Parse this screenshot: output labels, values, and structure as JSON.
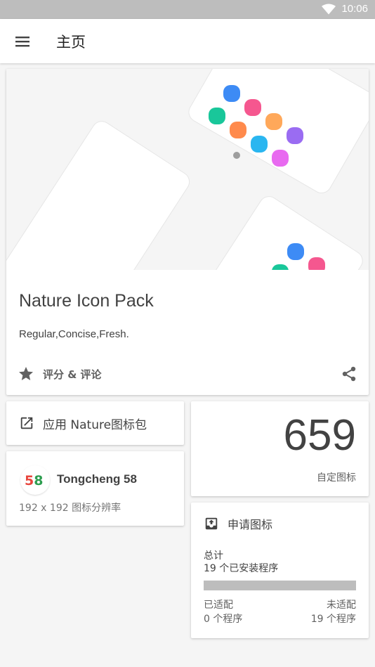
{
  "status_bar": {
    "time": "10:06",
    "wifi_icon": "wifi-icon"
  },
  "app_bar": {
    "title": "主页",
    "menu_icon": "menu-icon"
  },
  "hero": {
    "title": "Nature Icon Pack",
    "subtitle": "Regular,Concise,Fresh.",
    "rate_label": "评分 & 评论",
    "rate_icon": "star-icon",
    "share_icon": "share-icon",
    "dot_colors": [
      "#3d8bf5",
      "#f5578f",
      "#19c79a",
      "#ff8a4c",
      "#ffa85a",
      "#9a6cf2",
      "#2ab6f0",
      "#e86af0"
    ]
  },
  "apply": {
    "label": "应用 Nature图标包",
    "icon": "open-in-new-icon"
  },
  "launcher": {
    "name": "Tongcheng 58",
    "resolution": "192 x 192 图标分辨率",
    "logo_text": "58"
  },
  "icon_count": {
    "value": "659",
    "label": "自定图标"
  },
  "request": {
    "title": "申请图标",
    "icon": "inbox-upload-icon",
    "total_label": "总计",
    "total_value": "19 个已安装程序",
    "adapted_label": "已适配",
    "adapted_value": "0 个程序",
    "unadapted_label": "未适配",
    "unadapted_value": "19 个程序",
    "adapted_fraction": 0
  }
}
